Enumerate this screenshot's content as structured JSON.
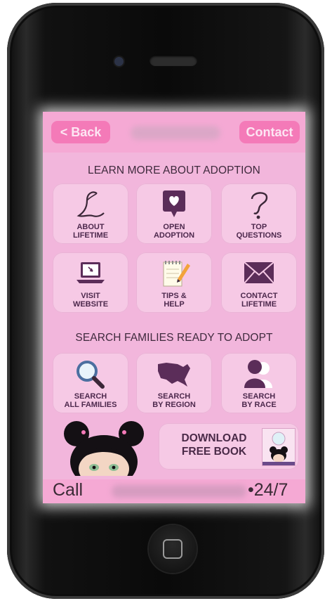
{
  "colors": {
    "screen_bg": "#f2b6dc",
    "tile_bg": "#f6c9e5",
    "accent": "#f47ab8",
    "icon": "#5b2d59",
    "text": "#4d294d"
  },
  "topbar": {
    "back_label": "< Back",
    "contact_label": "Contact"
  },
  "learn": {
    "title": "LEARN MORE ABOUT ADOPTION",
    "tiles": [
      {
        "line1": "ABOUT",
        "line2": "LIFETIME",
        "icon": "script-l-icon"
      },
      {
        "line1": "OPEN",
        "line2": "ADOPTION",
        "icon": "heart-speech-icon"
      },
      {
        "line1": "TOP",
        "line2": "QUESTIONS",
        "icon": "question-mark-icon"
      },
      {
        "line1": "VISIT",
        "line2": "WEBSITE",
        "icon": "laptop-icon"
      },
      {
        "line1": "TIPS &",
        "line2": "HELP",
        "icon": "notepad-pencil-icon"
      },
      {
        "line1": "CONTACT",
        "line2": "LIFETIME",
        "icon": "envelope-icon"
      }
    ]
  },
  "search": {
    "title": "SEARCH FAMILIES READY TO ADOPT",
    "tiles": [
      {
        "line1": "SEARCH",
        "line2": "ALL FAMILIES",
        "icon": "magnifier-icon"
      },
      {
        "line1": "SEARCH",
        "line2": "BY REGION",
        "icon": "usa-map-icon"
      },
      {
        "line1": "SEARCH",
        "line2": "BY RACE",
        "icon": "people-icon"
      }
    ]
  },
  "download": {
    "line1": "DOWNLOAD",
    "line2": "FREE BOOK"
  },
  "callbar": {
    "call_label": "Call",
    "hours_label": "•24/7"
  }
}
